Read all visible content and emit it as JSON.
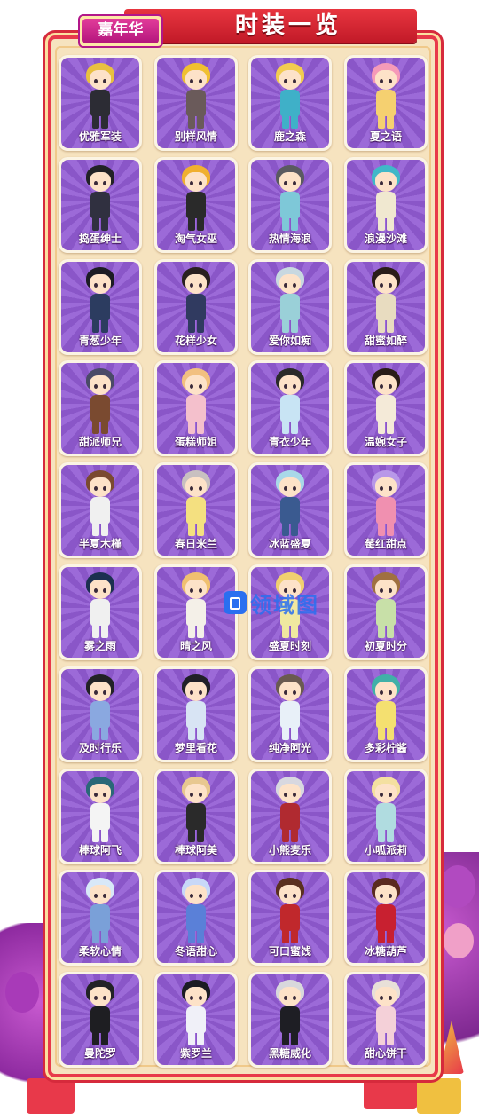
{
  "header": {
    "tag": "嘉年华",
    "title": "时装一览"
  },
  "watermark": "领域图",
  "colors": {
    "card_background": "#9c6ad8",
    "board_border": "#e8394a",
    "board_fill": "#f6e3bf",
    "header_ribbon": "#e8353f",
    "tag_fill": "#e23c9a"
  },
  "outfits": [
    {
      "name": "优雅军装",
      "hair": "#e8c040",
      "outfit": "#2c2c34"
    },
    {
      "name": "别样风情",
      "hair": "#f0c030",
      "outfit": "#6a5a5a"
    },
    {
      "name": "鹿之森",
      "hair": "#f2cc50",
      "outfit": "#3fb0c8"
    },
    {
      "name": "夏之语",
      "hair": "#f59ab8",
      "outfit": "#f5d070"
    },
    {
      "name": "捣蛋绅士",
      "hair": "#222226",
      "outfit": "#303040"
    },
    {
      "name": "淘气女巫",
      "hair": "#f0b030",
      "outfit": "#2a2a2a"
    },
    {
      "name": "热情海浪",
      "hair": "#5a5a60",
      "outfit": "#7ec8d8"
    },
    {
      "name": "浪漫沙滩",
      "hair": "#40b8c8",
      "outfit": "#f0e8d0"
    },
    {
      "name": "青葱少年",
      "hair": "#1c1c24",
      "outfit": "#2c3c60"
    },
    {
      "name": "花样少女",
      "hair": "#2a2020",
      "outfit": "#303a60"
    },
    {
      "name": "爱你如痴",
      "hair": "#c8d8e0",
      "outfit": "#9ad0d8"
    },
    {
      "name": "甜蜜如醉",
      "hair": "#2a1c18",
      "outfit": "#e8dcc0"
    },
    {
      "name": "甜派师兄",
      "hair": "#4a4a68",
      "outfit": "#7a4a30"
    },
    {
      "name": "蛋糕师姐",
      "hair": "#f2c080",
      "outfit": "#f4c0cc"
    },
    {
      "name": "青衣少年",
      "hair": "#2a2a2a",
      "outfit": "#c8e4f4"
    },
    {
      "name": "温婉女子",
      "hair": "#2a1c18",
      "outfit": "#f4ead8"
    },
    {
      "name": "半夏木槿",
      "hair": "#7a4a30",
      "outfit": "#f0f0f0"
    },
    {
      "name": "春日米兰",
      "hair": "#c8c0c0",
      "outfit": "#f4e080"
    },
    {
      "name": "冰蓝盛夏",
      "hair": "#a8d8e8",
      "outfit": "#3a5a90"
    },
    {
      "name": "莓红甜点",
      "hair": "#b898e8",
      "outfit": "#f090b0"
    },
    {
      "name": "雾之雨",
      "hair": "#1c3050",
      "outfit": "#f0f0f0"
    },
    {
      "name": "晴之风",
      "hair": "#f0c070",
      "outfit": "#f4f0e8"
    },
    {
      "name": "盛夏时刻",
      "hair": "#f0d070",
      "outfit": "#f0e8a0"
    },
    {
      "name": "初夏时分",
      "hair": "#a07040",
      "outfit": "#c8e0a8"
    },
    {
      "name": "及时行乐",
      "hair": "#222226",
      "outfit": "#8aa8e0"
    },
    {
      "name": "梦里看花",
      "hair": "#202028",
      "outfit": "#d8e4f4"
    },
    {
      "name": "纯净阿光",
      "hair": "#6a5a50",
      "outfit": "#e8f0f8"
    },
    {
      "name": "多彩柠酱",
      "hair": "#40b0a8",
      "outfit": "#f4e070"
    },
    {
      "name": "棒球阿飞",
      "hair": "#2a6878",
      "outfit": "#f4f4f4"
    },
    {
      "name": "棒球阿美",
      "hair": "#e8c890",
      "outfit": "#2a2a2a"
    },
    {
      "name": "小熊麦乐",
      "hair": "#d8d8e0",
      "outfit": "#b02a30"
    },
    {
      "name": "小呱派莉",
      "hair": "#f4e0a0",
      "outfit": "#b0dce0"
    },
    {
      "name": "柔软心情",
      "hair": "#d8e8f8",
      "outfit": "#7aa0d8"
    },
    {
      "name": "冬语甜心",
      "hair": "#c8d8f8",
      "outfit": "#5a80d8"
    },
    {
      "name": "可口蜜饯",
      "hair": "#5a3020",
      "outfit": "#c0282c"
    },
    {
      "name": "冰糖葫芦",
      "hair": "#5a2a20",
      "outfit": "#c82030"
    },
    {
      "name": "曼陀罗",
      "hair": "#222226",
      "outfit": "#1e1e22"
    },
    {
      "name": "紫罗兰",
      "hair": "#1c1c24",
      "outfit": "#f0f0f8"
    },
    {
      "name": "黑糖威化",
      "hair": "#d8d8dc",
      "outfit": "#1e1e24"
    },
    {
      "name": "甜心饼干",
      "hair": "#e8e0d8",
      "outfit": "#f4d0d8"
    }
  ]
}
